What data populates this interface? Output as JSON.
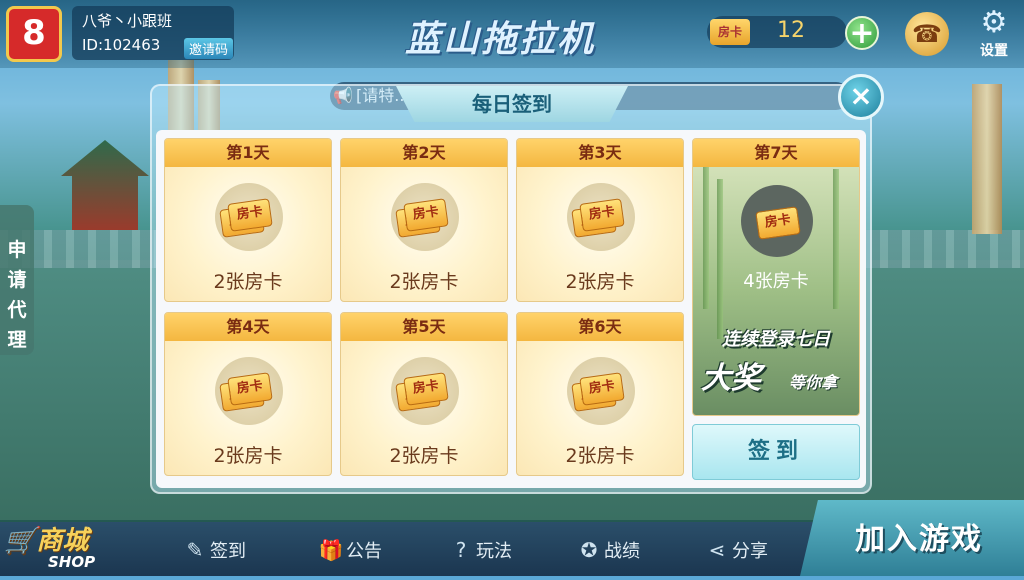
{
  "header": {
    "logo_text": "8",
    "user_name": "八爷丶小跟班",
    "user_id": "ID:102463",
    "invite_label": "邀请码",
    "game_title": "蓝山拖拉机",
    "card_label": "房卡",
    "card_count": "12",
    "add_label": "+",
    "settings_label": "设置"
  },
  "marquee": {
    "text": "[请特... 蓝山拖拉机，请大家文明"
  },
  "side": {
    "apply_agent": [
      "申",
      "请",
      "代",
      "理"
    ]
  },
  "dialog": {
    "title": "每日签到",
    "close_label": "×",
    "days": [
      {
        "label": "第1天",
        "reward": "2张房卡"
      },
      {
        "label": "第2天",
        "reward": "2张房卡"
      },
      {
        "label": "第3天",
        "reward": "2张房卡"
      },
      {
        "label": "第4天",
        "reward": "2张房卡"
      },
      {
        "label": "第5天",
        "reward": "2张房卡"
      },
      {
        "label": "第6天",
        "reward": "2张房卡"
      }
    ],
    "day7": {
      "label": "第7天",
      "reward": "4张房卡",
      "promo_line1": "连续登录七日",
      "promo_big": "大奖",
      "promo_small": "等你拿"
    },
    "ticket_text": "房卡",
    "signin_label": "签到"
  },
  "bottom": {
    "shop_label": "商城",
    "shop_sub": "SHOP",
    "nav": [
      {
        "label": "签到",
        "icon": "pen-icon"
      },
      {
        "label": "公告",
        "icon": "gift-icon"
      },
      {
        "label": "玩法",
        "icon": "question-icon"
      },
      {
        "label": "战绩",
        "icon": "medal-icon"
      },
      {
        "label": "分享",
        "icon": "share-icon"
      }
    ],
    "join_label": "加入游戏"
  }
}
